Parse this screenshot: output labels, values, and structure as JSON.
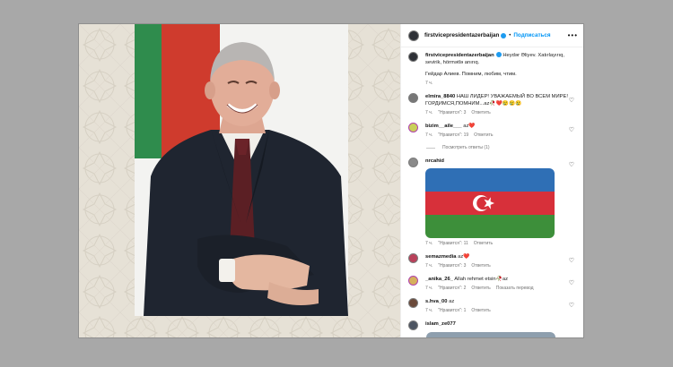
{
  "post": {
    "username": "firstvicepresidentazerbaijan",
    "follow_label": "Подписаться",
    "more_label": "•••",
    "caption_line1": "Heydər Əliyev. Xatırlayırıq, sevirik, hörmətlə anırıq.",
    "caption_line2": "Гейдар Алиев. Помним, любим, чтим.",
    "caption_time": "7 ч."
  },
  "comments": [
    {
      "user": "elmira_8840",
      "text": "НАШ ЛИДЕР! УВАЖАЕМЫЙ ВО ВСЕМ МИРЕ! ГОРДИМСЯ,ПОМНИМ...az🥀❤️😢😢😢",
      "time": "7 ч.",
      "likes": "\"Нравится\": 3",
      "reply": "Ответить"
    },
    {
      "user": "bizim__aile___",
      "text": "az❤️",
      "time": "7 ч.",
      "likes": "\"Нравится\": 19",
      "reply": "Ответить",
      "view_replies": "Посмотреть ответы (1)"
    },
    {
      "user": "nrcahid",
      "text": "",
      "time": "7 ч.",
      "likes": "\"Нравится\": 11",
      "reply": "Ответить"
    },
    {
      "user": "semazmedia",
      "text": "az❤️",
      "time": "7 ч.",
      "likes": "\"Нравится\": 3",
      "reply": "Ответить"
    },
    {
      "user": "_anika_26_",
      "text": "Allah rehmet etsin🥀az",
      "time": "7 ч.",
      "likes": "\"Нравится\": 2",
      "reply": "Ответить",
      "translate": "Показать перевод"
    },
    {
      "user": "s.hva_00",
      "text": "az",
      "time": "7 ч.",
      "likes": "\"Нравится\": 1",
      "reply": "Ответить"
    },
    {
      "user": "islam_ze077",
      "text": "",
      "time": "",
      "likes": "",
      "reply": ""
    }
  ],
  "colors": {
    "accent": "#0095f6",
    "verified": "#1d9bf0",
    "flag_blue": "#00b5e2",
    "flag_red": "#ef3340",
    "flag_green": "#509e2f"
  }
}
